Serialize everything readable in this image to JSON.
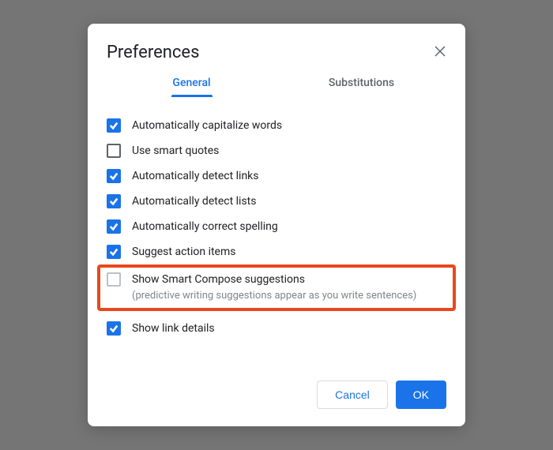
{
  "dialog": {
    "title": "Preferences",
    "tabs": {
      "general": "General",
      "substitutions": "Substitutions"
    },
    "options": {
      "capitalize": "Automatically capitalize words",
      "smartquotes": "Use smart quotes",
      "detectlinks": "Automatically detect links",
      "detectlists": "Automatically detect lists",
      "spelling": "Automatically correct spelling",
      "actionitems": "Suggest action items",
      "smartcompose": "Show Smart Compose suggestions",
      "smartcompose_hint": "(predictive writing suggestions appear as you write sentences)",
      "linkdetails": "Show link details"
    },
    "buttons": {
      "cancel": "Cancel",
      "ok": "OK"
    }
  }
}
